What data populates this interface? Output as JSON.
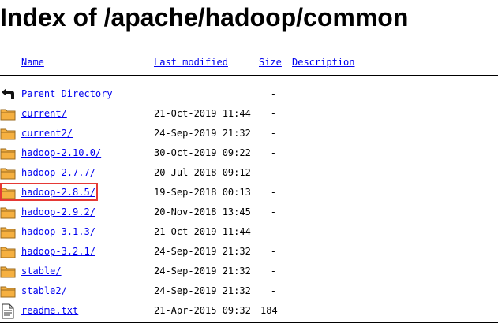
{
  "title": "Index of /apache/hadoop/common",
  "columns": {
    "name": "Name",
    "last_modified": "Last modified",
    "size": "Size",
    "description": "Description"
  },
  "rows": [
    {
      "name": "Parent Directory",
      "date": "",
      "size": "-",
      "icon": "parent-directory-icon"
    },
    {
      "name": "current/",
      "date": "21-Oct-2019 11:44",
      "size": "-",
      "icon": "folder-icon"
    },
    {
      "name": "current2/",
      "date": "24-Sep-2019 21:32",
      "size": "-",
      "icon": "folder-icon"
    },
    {
      "name": "hadoop-2.10.0/",
      "date": "30-Oct-2019 09:22",
      "size": "-",
      "icon": "folder-icon"
    },
    {
      "name": "hadoop-2.7.7/",
      "date": "20-Jul-2018 09:12",
      "size": "-",
      "icon": "folder-icon"
    },
    {
      "name": "hadoop-2.8.5/",
      "date": "19-Sep-2018 00:13",
      "size": "-",
      "icon": "folder-icon",
      "highlighted": true
    },
    {
      "name": "hadoop-2.9.2/",
      "date": "20-Nov-2018 13:45",
      "size": "-",
      "icon": "folder-icon"
    },
    {
      "name": "hadoop-3.1.3/",
      "date": "21-Oct-2019 11:44",
      "size": "-",
      "icon": "folder-icon"
    },
    {
      "name": "hadoop-3.2.1/",
      "date": "24-Sep-2019 21:32",
      "size": "-",
      "icon": "folder-icon"
    },
    {
      "name": "stable/",
      "date": "24-Sep-2019 21:32",
      "size": "-",
      "icon": "folder-icon"
    },
    {
      "name": "stable2/",
      "date": "24-Sep-2019 21:32",
      "size": "-",
      "icon": "folder-icon"
    },
    {
      "name": "readme.txt",
      "date": "21-Apr-2015 09:32",
      "size": "184",
      "icon": "text-file-icon"
    }
  ],
  "colors": {
    "link": "#0000ee",
    "highlight_border": "#e53935",
    "folder_fill": "#f5b041",
    "folder_stroke": "#9a6a1e"
  }
}
